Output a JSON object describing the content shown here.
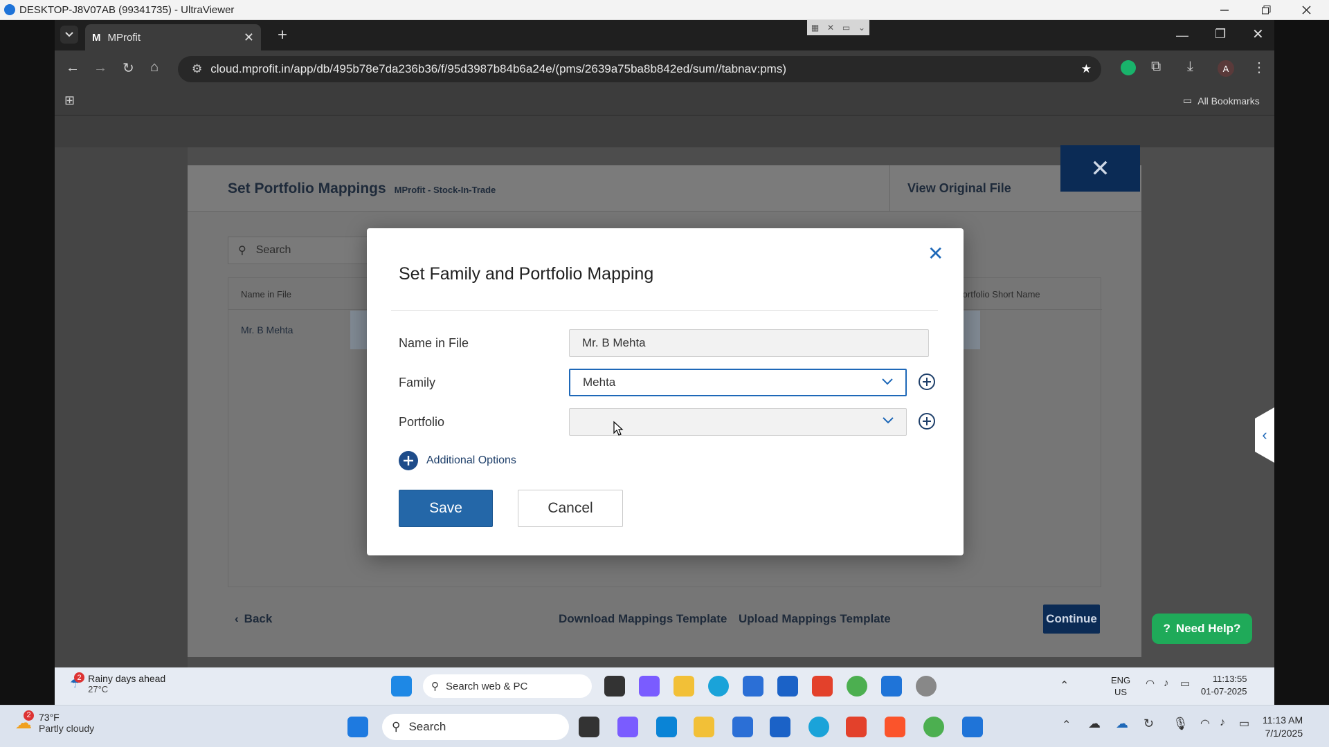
{
  "ultraviewer": {
    "title": "DESKTOP-J8V07AB (99341735) - UltraViewer"
  },
  "browser": {
    "tab_title": "MProfit",
    "url": "cloud.mprofit.in/app/db/495b78e7da236b36/f/95d3987b84b6a24e/(pms/2639a75ba8b842ed/sum//tabnav:pms)",
    "bookmarks_label": "All Bookmarks",
    "profile_initial": "A"
  },
  "panel": {
    "title": "Set Portfolio Mappings",
    "subtitle": "MProfit - Stock-In-Trade",
    "view_original_label": "View Original File",
    "search_placeholder": "Search",
    "col_name_in_file": "Name in File",
    "col_portfolio_short_name": "Portfolio Short Name",
    "row_name": "Mr. B Mehta",
    "back_label": "Back",
    "download_template_label": "Download Mappings Template",
    "upload_template_label": "Upload Mappings Template",
    "continue_label": "Continue"
  },
  "dialog": {
    "title": "Set Family and Portfolio Mapping",
    "name_in_file_label": "Name in File",
    "name_in_file_value": "Mr. B Mehta",
    "family_label": "Family",
    "family_value": "Mehta",
    "portfolio_label": "Portfolio",
    "portfolio_value": "",
    "additional_options_label": "Additional Options",
    "save_label": "Save",
    "cancel_label": "Cancel"
  },
  "need_help_label": "Need Help?",
  "remote_taskbar": {
    "weather_title": "Rainy days ahead",
    "weather_temp": "27°C",
    "weather_badge": "2",
    "search_label": "Search web & PC",
    "lang_line1": "ENG",
    "lang_line2": "US",
    "time": "11:13:55",
    "date": "01-07-2025"
  },
  "local_taskbar": {
    "weather_temp": "73°F",
    "weather_desc": "Partly cloudy",
    "weather_badge": "2",
    "search_label": "Search",
    "time": "11:13 AM",
    "date": "7/1/2025"
  },
  "colors": {
    "primary": "#2467a8",
    "panel_close_bg": "#0b2b55",
    "need_help": "#1faa59"
  }
}
